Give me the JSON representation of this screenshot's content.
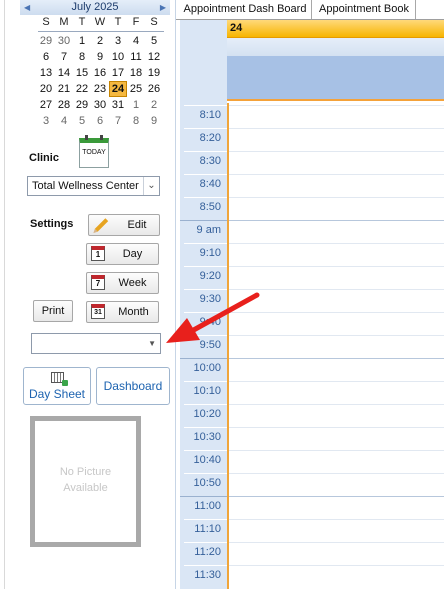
{
  "calendar": {
    "title": "July 2025",
    "prev_icon": "◀",
    "next_icon": "▶",
    "dow": [
      "S",
      "M",
      "T",
      "W",
      "T",
      "F",
      "S"
    ],
    "weeks": [
      [
        "29",
        "30",
        "1",
        "2",
        "3",
        "4",
        "5"
      ],
      [
        "6",
        "7",
        "8",
        "9",
        "10",
        "11",
        "12"
      ],
      [
        "13",
        "14",
        "15",
        "16",
        "17",
        "18",
        "19"
      ],
      [
        "20",
        "21",
        "22",
        "23",
        "24",
        "25",
        "26"
      ],
      [
        "27",
        "28",
        "29",
        "30",
        "31",
        "1",
        "2"
      ],
      [
        "3",
        "4",
        "5",
        "6",
        "7",
        "8",
        "9"
      ]
    ],
    "selected_day": "24"
  },
  "clinic": {
    "label": "Clinic",
    "today_label": "TODAY",
    "value": "Total Wellness Center"
  },
  "settings": {
    "label": "Settings"
  },
  "buttons": {
    "edit": "Edit",
    "day": "Day",
    "day_icon": "1",
    "week": "Week",
    "week_icon": "7",
    "print": "Print",
    "month": "Month",
    "month_icon": "31",
    "day_sheet": "Day Sheet",
    "dashboard": "Dashboard"
  },
  "photo": {
    "line1": "No Picture",
    "line2": "Available"
  },
  "tabs": [
    "Appointment Dash Board",
    "Appointment Book"
  ],
  "schedule": {
    "day_header": "24",
    "times": [
      "8:10",
      "8:20",
      "8:30",
      "8:40",
      "8:50",
      "9 am",
      "9:10",
      "9:20",
      "9:30",
      "9:40",
      "9:50",
      "10:00",
      "10:10",
      "10:20",
      "10:30",
      "10:40",
      "10:50",
      "11:00",
      "11:10",
      "11:20",
      "11:30"
    ]
  },
  "colors": {
    "today_highlight": "#f5b840",
    "time_strip": "#dae6f5",
    "allday": "#a7c1e5",
    "arrow": "#e8201c"
  }
}
